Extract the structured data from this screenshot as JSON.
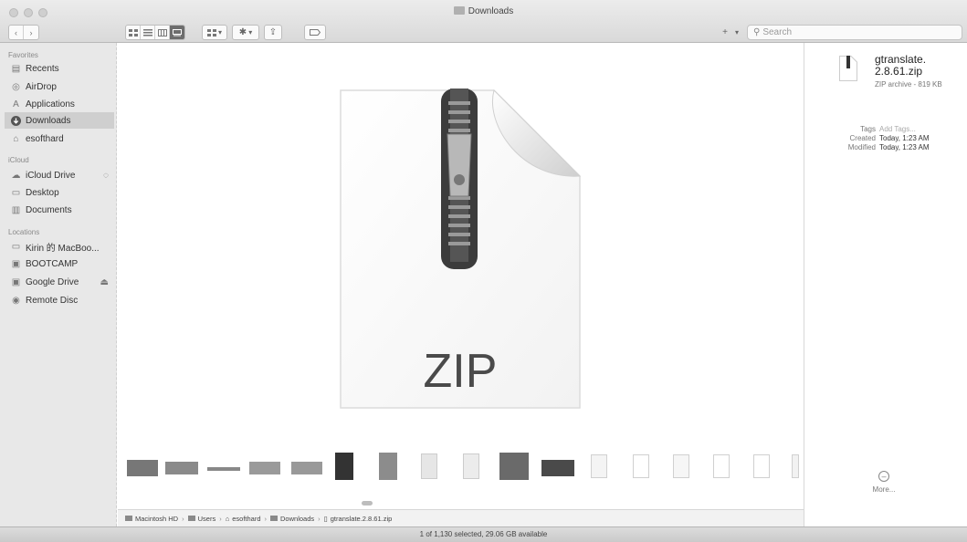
{
  "window": {
    "title": "Downloads"
  },
  "toolbar": {
    "back": "‹",
    "forward": "›",
    "view_icons": [
      "icon-view",
      "list-view",
      "column-view",
      "gallery-view"
    ],
    "group_icon": "group-icon",
    "action_icon": "gear-icon",
    "share_icon": "share-icon",
    "tag_icon": "tag-icon",
    "add": "+",
    "add_dropdown": "▾",
    "search_placeholder": "Search"
  },
  "sidebar": {
    "favorites_label": "Favorites",
    "favorites": [
      {
        "label": "Recents",
        "icon": "recents-icon"
      },
      {
        "label": "AirDrop",
        "icon": "airdrop-icon"
      },
      {
        "label": "Applications",
        "icon": "applications-icon"
      },
      {
        "label": "Downloads",
        "icon": "downloads-icon",
        "selected": true
      },
      {
        "label": "esofthard",
        "icon": "home-icon"
      }
    ],
    "icloud_label": "iCloud",
    "icloud": [
      {
        "label": "iCloud Drive",
        "icon": "cloud-icon"
      },
      {
        "label": "Desktop",
        "icon": "desktop-icon"
      },
      {
        "label": "Documents",
        "icon": "documents-icon"
      }
    ],
    "locations_label": "Locations",
    "locations": [
      {
        "label": "Kirin 的 MacBoo...",
        "icon": "laptop-icon"
      },
      {
        "label": "BOOTCAMP",
        "icon": "disk-icon"
      },
      {
        "label": "Google Drive",
        "icon": "drive-icon",
        "eject": "⏏"
      },
      {
        "label": "Remote Disc",
        "icon": "disc-icon"
      }
    ]
  },
  "preview": {
    "file_type_label": "ZIP"
  },
  "inspector": {
    "file_name": "gtranslate.\n2.8.61.zip",
    "kind_size": "ZIP archive - 819 KB",
    "tags_label": "Tags",
    "tags_placeholder": "Add Tags...",
    "created_label": "Created",
    "created_value": "Today, 1:23 AM",
    "modified_label": "Modified",
    "modified_value": "Today, 1:23 AM",
    "more_label": "More..."
  },
  "pathbar": {
    "items": [
      "Macintosh HD",
      "Users",
      "esofthard",
      "Downloads",
      "gtranslate.2.8.61.zip"
    ]
  },
  "status": {
    "text": "1 of 1,130 selected, 29.06 GB available"
  }
}
